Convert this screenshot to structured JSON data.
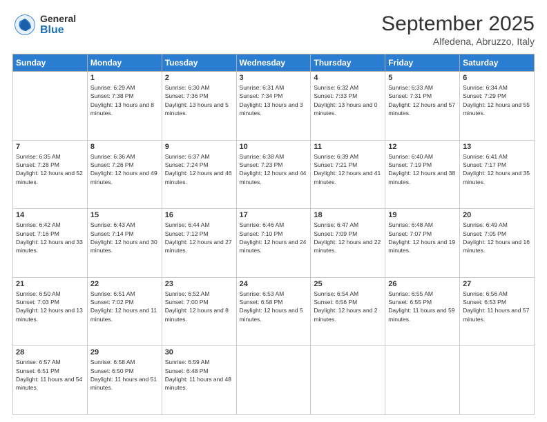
{
  "header": {
    "logo_general": "General",
    "logo_blue": "Blue",
    "month_title": "September 2025",
    "location": "Alfedena, Abruzzo, Italy"
  },
  "days_of_week": [
    "Sunday",
    "Monday",
    "Tuesday",
    "Wednesday",
    "Thursday",
    "Friday",
    "Saturday"
  ],
  "weeks": [
    [
      {
        "num": "",
        "sunrise": "",
        "sunset": "",
        "daylight": ""
      },
      {
        "num": "1",
        "sunrise": "Sunrise: 6:29 AM",
        "sunset": "Sunset: 7:38 PM",
        "daylight": "Daylight: 13 hours and 8 minutes."
      },
      {
        "num": "2",
        "sunrise": "Sunrise: 6:30 AM",
        "sunset": "Sunset: 7:36 PM",
        "daylight": "Daylight: 13 hours and 5 minutes."
      },
      {
        "num": "3",
        "sunrise": "Sunrise: 6:31 AM",
        "sunset": "Sunset: 7:34 PM",
        "daylight": "Daylight: 13 hours and 3 minutes."
      },
      {
        "num": "4",
        "sunrise": "Sunrise: 6:32 AM",
        "sunset": "Sunset: 7:33 PM",
        "daylight": "Daylight: 13 hours and 0 minutes."
      },
      {
        "num": "5",
        "sunrise": "Sunrise: 6:33 AM",
        "sunset": "Sunset: 7:31 PM",
        "daylight": "Daylight: 12 hours and 57 minutes."
      },
      {
        "num": "6",
        "sunrise": "Sunrise: 6:34 AM",
        "sunset": "Sunset: 7:29 PM",
        "daylight": "Daylight: 12 hours and 55 minutes."
      }
    ],
    [
      {
        "num": "7",
        "sunrise": "Sunrise: 6:35 AM",
        "sunset": "Sunset: 7:28 PM",
        "daylight": "Daylight: 12 hours and 52 minutes."
      },
      {
        "num": "8",
        "sunrise": "Sunrise: 6:36 AM",
        "sunset": "Sunset: 7:26 PM",
        "daylight": "Daylight: 12 hours and 49 minutes."
      },
      {
        "num": "9",
        "sunrise": "Sunrise: 6:37 AM",
        "sunset": "Sunset: 7:24 PM",
        "daylight": "Daylight: 12 hours and 46 minutes."
      },
      {
        "num": "10",
        "sunrise": "Sunrise: 6:38 AM",
        "sunset": "Sunset: 7:23 PM",
        "daylight": "Daylight: 12 hours and 44 minutes."
      },
      {
        "num": "11",
        "sunrise": "Sunrise: 6:39 AM",
        "sunset": "Sunset: 7:21 PM",
        "daylight": "Daylight: 12 hours and 41 minutes."
      },
      {
        "num": "12",
        "sunrise": "Sunrise: 6:40 AM",
        "sunset": "Sunset: 7:19 PM",
        "daylight": "Daylight: 12 hours and 38 minutes."
      },
      {
        "num": "13",
        "sunrise": "Sunrise: 6:41 AM",
        "sunset": "Sunset: 7:17 PM",
        "daylight": "Daylight: 12 hours and 35 minutes."
      }
    ],
    [
      {
        "num": "14",
        "sunrise": "Sunrise: 6:42 AM",
        "sunset": "Sunset: 7:16 PM",
        "daylight": "Daylight: 12 hours and 33 minutes."
      },
      {
        "num": "15",
        "sunrise": "Sunrise: 6:43 AM",
        "sunset": "Sunset: 7:14 PM",
        "daylight": "Daylight: 12 hours and 30 minutes."
      },
      {
        "num": "16",
        "sunrise": "Sunrise: 6:44 AM",
        "sunset": "Sunset: 7:12 PM",
        "daylight": "Daylight: 12 hours and 27 minutes."
      },
      {
        "num": "17",
        "sunrise": "Sunrise: 6:46 AM",
        "sunset": "Sunset: 7:10 PM",
        "daylight": "Daylight: 12 hours and 24 minutes."
      },
      {
        "num": "18",
        "sunrise": "Sunrise: 6:47 AM",
        "sunset": "Sunset: 7:09 PM",
        "daylight": "Daylight: 12 hours and 22 minutes."
      },
      {
        "num": "19",
        "sunrise": "Sunrise: 6:48 AM",
        "sunset": "Sunset: 7:07 PM",
        "daylight": "Daylight: 12 hours and 19 minutes."
      },
      {
        "num": "20",
        "sunrise": "Sunrise: 6:49 AM",
        "sunset": "Sunset: 7:05 PM",
        "daylight": "Daylight: 12 hours and 16 minutes."
      }
    ],
    [
      {
        "num": "21",
        "sunrise": "Sunrise: 6:50 AM",
        "sunset": "Sunset: 7:03 PM",
        "daylight": "Daylight: 12 hours and 13 minutes."
      },
      {
        "num": "22",
        "sunrise": "Sunrise: 6:51 AM",
        "sunset": "Sunset: 7:02 PM",
        "daylight": "Daylight: 12 hours and 11 minutes."
      },
      {
        "num": "23",
        "sunrise": "Sunrise: 6:52 AM",
        "sunset": "Sunset: 7:00 PM",
        "daylight": "Daylight: 12 hours and 8 minutes."
      },
      {
        "num": "24",
        "sunrise": "Sunrise: 6:53 AM",
        "sunset": "Sunset: 6:58 PM",
        "daylight": "Daylight: 12 hours and 5 minutes."
      },
      {
        "num": "25",
        "sunrise": "Sunrise: 6:54 AM",
        "sunset": "Sunset: 6:56 PM",
        "daylight": "Daylight: 12 hours and 2 minutes."
      },
      {
        "num": "26",
        "sunrise": "Sunrise: 6:55 AM",
        "sunset": "Sunset: 6:55 PM",
        "daylight": "Daylight: 11 hours and 59 minutes."
      },
      {
        "num": "27",
        "sunrise": "Sunrise: 6:56 AM",
        "sunset": "Sunset: 6:53 PM",
        "daylight": "Daylight: 11 hours and 57 minutes."
      }
    ],
    [
      {
        "num": "28",
        "sunrise": "Sunrise: 6:57 AM",
        "sunset": "Sunset: 6:51 PM",
        "daylight": "Daylight: 11 hours and 54 minutes."
      },
      {
        "num": "29",
        "sunrise": "Sunrise: 6:58 AM",
        "sunset": "Sunset: 6:50 PM",
        "daylight": "Daylight: 11 hours and 51 minutes."
      },
      {
        "num": "30",
        "sunrise": "Sunrise: 6:59 AM",
        "sunset": "Sunset: 6:48 PM",
        "daylight": "Daylight: 11 hours and 48 minutes."
      },
      {
        "num": "",
        "sunrise": "",
        "sunset": "",
        "daylight": ""
      },
      {
        "num": "",
        "sunrise": "",
        "sunset": "",
        "daylight": ""
      },
      {
        "num": "",
        "sunrise": "",
        "sunset": "",
        "daylight": ""
      },
      {
        "num": "",
        "sunrise": "",
        "sunset": "",
        "daylight": ""
      }
    ]
  ]
}
